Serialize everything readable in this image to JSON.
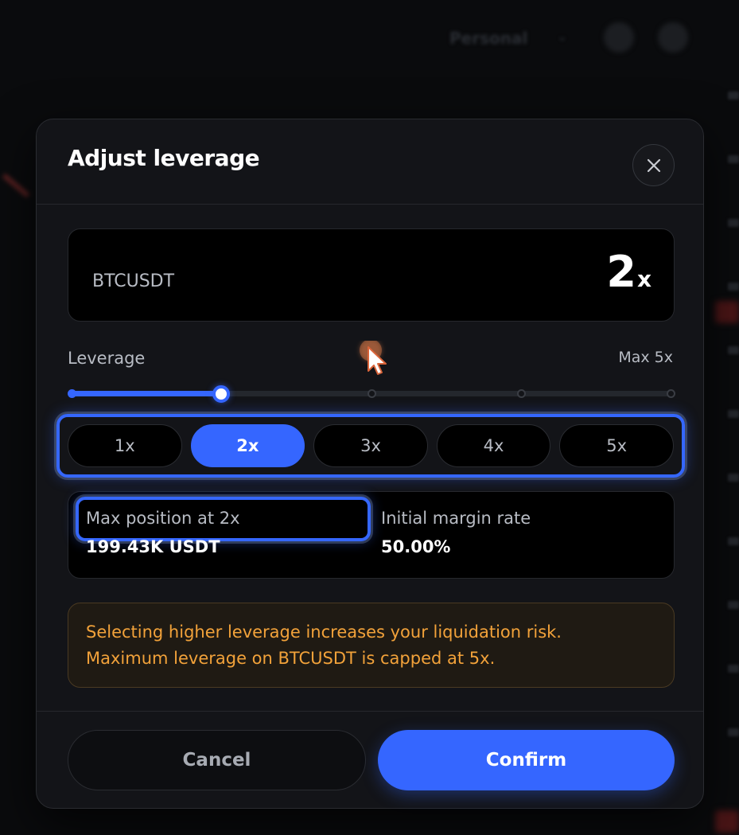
{
  "background": {
    "topbar_text": "Personal"
  },
  "modal": {
    "title": "Adjust leverage",
    "pair": {
      "symbol": "BTCUSDT",
      "leverage_value": "2",
      "leverage_unit": "x"
    },
    "leverage": {
      "label": "Leverage",
      "max_label": "Max 5x",
      "current": 2,
      "min": 1,
      "max": 5
    },
    "presets": [
      {
        "label": "1x",
        "selected": false
      },
      {
        "label": "2x",
        "selected": true
      },
      {
        "label": "3x",
        "selected": false
      },
      {
        "label": "4x",
        "selected": false
      },
      {
        "label": "5x",
        "selected": false
      }
    ],
    "info": {
      "max_position_label": "Max position at 2x",
      "max_position_value": "199.43K USDT",
      "margin_label": "Initial margin rate",
      "margin_value": "50.00%"
    },
    "warning": {
      "line1": "Selecting higher leverage increases your liquidation risk.",
      "line2": "Maximum leverage on BTCUSDT is capped at 5x."
    },
    "buttons": {
      "cancel": "Cancel",
      "confirm": "Confirm"
    }
  },
  "colors": {
    "accent": "#3566ff",
    "warning": "#f2a23a",
    "surface": "#131418"
  }
}
